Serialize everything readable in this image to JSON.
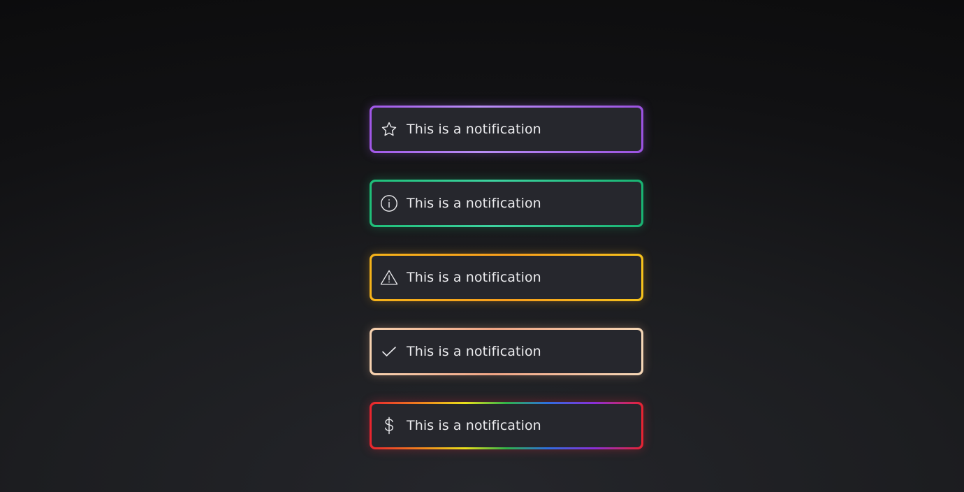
{
  "notifications": [
    {
      "variant": "purple",
      "icon": "star-icon",
      "message": "This is a notification"
    },
    {
      "variant": "green",
      "icon": "info-icon",
      "message": "This is a notification"
    },
    {
      "variant": "yellow",
      "icon": "warning-icon",
      "message": "This is a notification"
    },
    {
      "variant": "peach",
      "icon": "check-icon",
      "message": "This is a notification"
    },
    {
      "variant": "rainbow",
      "icon": "dollar-icon",
      "message": "This is a notification"
    }
  ],
  "colors": {
    "background": "#1c1d20",
    "card": "#26272d",
    "text": "#ececef",
    "purple": "#a157e8",
    "green": "#1fbf79",
    "yellow": "#f5b31a",
    "peach": "#f0a585",
    "rainbow_edge": "#e8232f"
  }
}
